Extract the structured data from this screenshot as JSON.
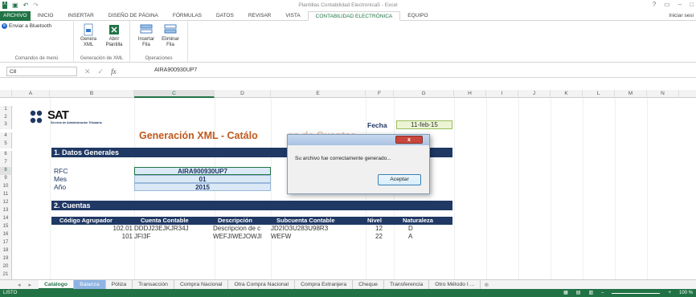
{
  "titlebar": {
    "title": "Plantillas Contabilidad Electronica5 - Excel",
    "help": "?",
    "minimize": "–",
    "maximize": "□"
  },
  "ribbon_tabs": [
    "ARCHIVO",
    "INICIO",
    "INSERTAR",
    "DISEÑO DE PÁGINA",
    "FÓRMULAS",
    "DATOS",
    "REVISAR",
    "VISTA",
    "CONTABILIDAD ELECTRÓNICA",
    "EQUIPO"
  ],
  "signin": "Iniciar sesi",
  "ribbon": {
    "bluetooth": "Enviar a Bluetooth",
    "group1": "Comandos de menú",
    "genera": "Genera XML",
    "abrir": "Abrir Plantilla",
    "group2": "Generación de XML",
    "insertar": "Insertar Fila",
    "eliminar": "Eliminar Fila",
    "group3": "Operaciones"
  },
  "namebox": "C8",
  "fx": "fx",
  "formula": "AIRA900930UP7",
  "columns": [
    "A",
    "B",
    "C",
    "D",
    "E",
    "F",
    "G",
    "H",
    "I",
    "J",
    "K",
    "L",
    "M",
    "N"
  ],
  "rows": [
    "1",
    "2",
    "3",
    "4",
    "5",
    "6",
    "7",
    "8",
    "9",
    "10",
    "11",
    "12",
    "13",
    "14",
    "15",
    "16",
    "17",
    "18",
    "19",
    "20",
    "21"
  ],
  "sheet": {
    "logo": "SAT",
    "logo_sub": "Servicio de Administración Tributaria",
    "heading": "Generación XML - Catálo",
    "heading_tail": "go de Cuentas",
    "fecha_label": "Fecha",
    "fecha_value": "11-feb-15",
    "sec1": "1. Datos Generales",
    "rfc_label": "RFC",
    "rfc_value": "AIRA900930UP7",
    "mes_label": "Mes",
    "mes_value": "01",
    "anio_label": "Año",
    "anio_value": "2015",
    "sec2": "2. Cuentas",
    "headers": [
      "Código Agrupador",
      "Cuenta Contable",
      "Descripción",
      "Subcuenta Contable",
      "Nivel",
      "Naturaleza"
    ],
    "rows": [
      {
        "codigo": "102.01",
        "cuenta": "DDDJ23EJKJR34J",
        "desc": "Descripcion de c",
        "sub": "JD2IO3U283U98R3",
        "nivel": "12",
        "nat": "D"
      },
      {
        "codigo": "101",
        "cuenta": "JFI3F",
        "desc": "WEFJIWEJOWJI",
        "sub": "WEFW",
        "nivel": "22",
        "nat": "A"
      }
    ]
  },
  "dialog": {
    "close": "x",
    "message": "Su archivo fue correctamente generado...",
    "ok": "Aceptar"
  },
  "sheet_tabs": [
    "Catálogo",
    "Balanza",
    "Póliza",
    "Transacción",
    "Compra Nacional",
    "Otra Compra Nacional",
    "Compra Extranjera",
    "Cheque",
    "Transferencia",
    "Otro Método I ..."
  ],
  "status": "LISTO",
  "zoom": "100 %",
  "colors": {
    "excel_green": "#217346",
    "section_bg": "#1f3864",
    "heading": "#c0581b",
    "header_row": "#1f3864"
  }
}
